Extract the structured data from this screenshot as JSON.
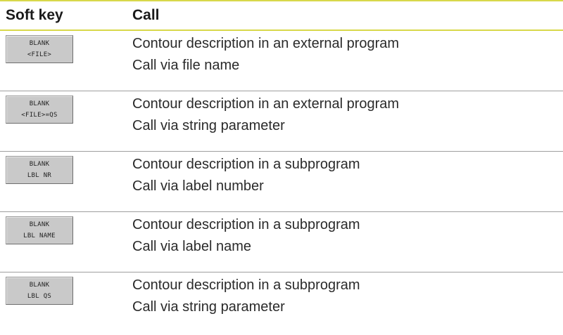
{
  "header": {
    "softkey": "Soft key",
    "call": "Call"
  },
  "rows": [
    {
      "key_line1": "BLANK",
      "key_line2": "<FILE>",
      "description": "Contour description in an external program",
      "call": "Call via file name"
    },
    {
      "key_line1": "BLANK",
      "key_line2": "<FILE>=QS",
      "description": "Contour description in an external program",
      "call": "Call via string parameter"
    },
    {
      "key_line1": "BLANK",
      "key_line2": "LBL NR",
      "description": "Contour description in a subprogram",
      "call": "Call via label number"
    },
    {
      "key_line1": "BLANK",
      "key_line2": "LBL NAME",
      "description": "Contour description in a subprogram",
      "call": "Call via label name"
    },
    {
      "key_line1": "BLANK",
      "key_line2": "LBL QS",
      "description": "Contour description in a subprogram",
      "call": "Call via string parameter"
    }
  ],
  "colors": {
    "header_rule": "#d8d84a",
    "row_rule": "#9e9e9e",
    "softkey_bg": "#c9c9c9"
  }
}
